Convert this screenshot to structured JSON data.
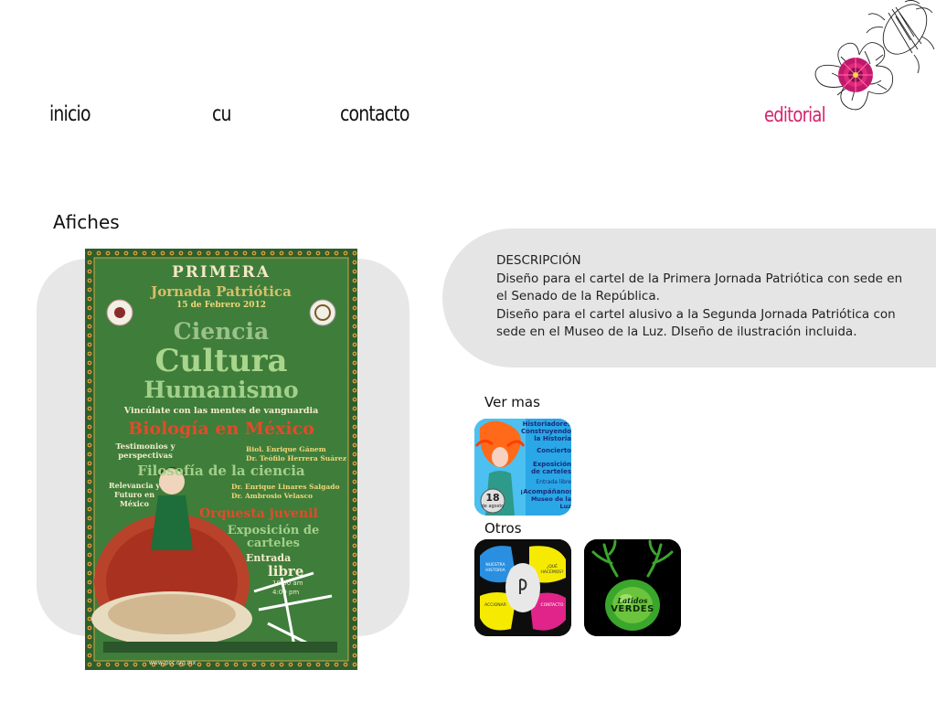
{
  "nav": {
    "inicio": "inicio",
    "cu": "cu",
    "contacto": "contacto",
    "editorial": "editorial"
  },
  "section": {
    "title": "Afiches"
  },
  "poster": {
    "heading": "PRIMERA",
    "subheading": "Jornada Patriótica",
    "date": "15 de Febrero 2012",
    "line1": "Ciencia",
    "line2": "Cultura",
    "line3": "Humanismo",
    "tagline": "Vincúlate con las mentes de vanguardia",
    "topic1": "Biología en México",
    "talk1_left": "Testimonios y perspectivas",
    "talk1_right1": "Biol. Enrique Gánem",
    "talk1_right2": "Dr. Teófilo Herrera Suárez",
    "topic2": "Filosofía de la ciencia",
    "talk2_left": "Relevancia y Futuro en México",
    "talk2_right1": "Dr. Enrique Linares Salgado",
    "talk2_right2": "Dr. Ambrosio Velasco",
    "topic3": "Orquesta juvenil",
    "topic4": "Exposición de carteles",
    "entrada": "Entrada",
    "libre": "libre",
    "time1": "10:00 am",
    "time2": "4:00 pm",
    "footer": "www.jpcc.org.mx"
  },
  "description": {
    "heading": "DESCRIPCIÓN",
    "lines": [
      "Diseño para el cartel de la Primera Jornada Patriótica con sede en",
      "el Senado de la República.",
      "Diseño para el cartel alusivo a la Segunda Jornada Patriótica con",
      "sede en el Museo de la Luz. DIseño de ilustración incluida."
    ]
  },
  "ver_mas": {
    "label": "Ver mas",
    "thumb": {
      "lines": [
        "Historiadores",
        "Construyendo",
        "la Historia",
        "Concierto",
        "Exposición",
        "de carteles",
        "Entrada libre",
        "¡Acompáñanos!",
        "Museo de la Luz"
      ],
      "date_num": "18",
      "date_text": "de agosto"
    }
  },
  "otros": {
    "label": "Otros",
    "thumb1": {
      "quad_tl": "NUESTRA HISTORIA",
      "quad_tr": "¿QUÉ HACEMOS?",
      "quad_bl": "ACCIONAR",
      "quad_br": "CONTACTO"
    },
    "thumb2": {
      "line1": "Latidos",
      "line2": "VERDES"
    }
  },
  "colors": {
    "accent": "#d6246e",
    "panel": "#e6e6e6",
    "poster_green": "#3f7d3a"
  }
}
